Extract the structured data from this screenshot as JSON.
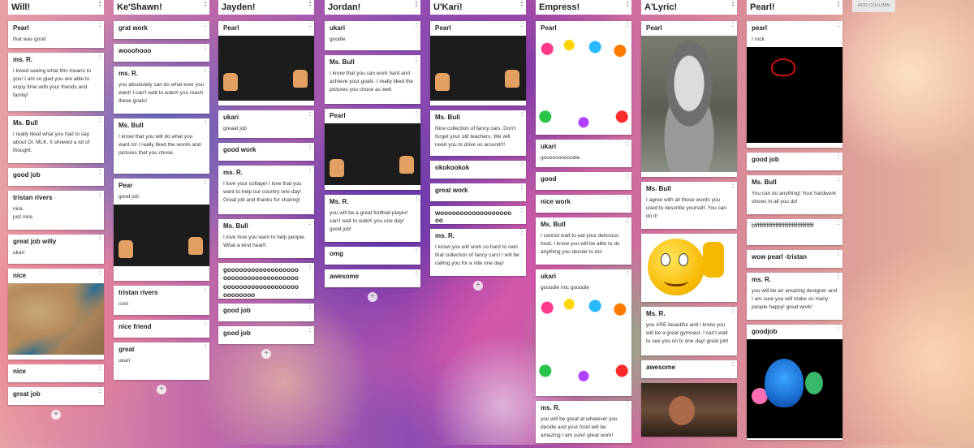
{
  "board": {
    "add_column_label": "ADD COLUMN",
    "add_card_symbol": "+",
    "kebab_symbol": "⋮"
  },
  "columns": [
    {
      "title": "Will!",
      "cards": [
        {
          "author": "Pearl",
          "body": "that was good"
        },
        {
          "author": "ms. R.",
          "body": "I loved seeing what this means to you! I am so glad you are able to enjoy time with your friends and family!"
        },
        {
          "author": "Ms. Bull",
          "body": "I really liked what you had to say about Dr. MLK.  It showed a lot of thought."
        },
        {
          "author": "good job",
          "body": ""
        },
        {
          "author": "tristan rivers",
          "body": "nice.\njust nice."
        },
        {
          "author": "great job willy",
          "body": "ukari"
        },
        {
          "author": "nice",
          "body": "",
          "image": "satellite-map"
        },
        {
          "author": "nice",
          "body": ""
        },
        {
          "author": "great job",
          "body": ""
        }
      ]
    },
    {
      "title": "Ke'Shawn!",
      "cards": [
        {
          "author": "grat work",
          "body": ""
        },
        {
          "author": "wooohooo",
          "body": ""
        },
        {
          "author": "ms. R.",
          "body": "you absolutely can do what ever you want! I can't wait to watch you reach these goals!"
        },
        {
          "author": "Ms. Bull",
          "body": "I know that you will do what you want to!  I really liked the words and pictures that you chose."
        },
        {
          "author": "Pear",
          "body": "good job",
          "image": "good-job-chalkboard"
        },
        {
          "author": "tristan rivers",
          "body": "cool"
        },
        {
          "author": "nice friend",
          "body": ""
        },
        {
          "author": "great",
          "body": "ukari"
        }
      ]
    },
    {
      "title": "Jayden!",
      "cards": [
        {
          "author": "Pearl",
          "body": "",
          "image": "good-job-chalkboard"
        },
        {
          "author": "ukari",
          "body": "greaat job"
        },
        {
          "author": "good work",
          "body": ""
        },
        {
          "author": "ms. R.",
          "body": "I love your collage! I love that you want to help our country one day! Great job and thanks for sharing!"
        },
        {
          "author": "Ms. Bull",
          "body": "I love how you want to help people.  What a kind heart!"
        },
        {
          "author": "goooooooooooooooooooooooooooooooooooooooooooooooooooooooooooooooo",
          "body": ""
        },
        {
          "author": "good job",
          "body": ""
        },
        {
          "author": "good job",
          "body": ""
        }
      ]
    },
    {
      "title": "Jordan!",
      "cards": [
        {
          "author": "ukari",
          "body": "goodie"
        },
        {
          "author": "Ms. Bull",
          "body": "I know that you can work hard and achieve your goals.  I really liked the pictures you chose as well."
        },
        {
          "author": "Pearl",
          "body": "",
          "image": "good-job-chalkboard"
        },
        {
          "author": "Ms. R.",
          "body": "you will be a great football player! can't wait to watch you one day! good job!"
        },
        {
          "author": "omg",
          "body": ""
        },
        {
          "author": "awesome",
          "body": ""
        }
      ]
    },
    {
      "title": "U'Kari!",
      "cards": [
        {
          "author": "Pearl",
          "body": "",
          "image": "good-job-chalkboard"
        },
        {
          "author": "Ms. Bull",
          "body": "Nice collection of fancy cars.  Don't forget your old teachers.  We will need you to drive us around!!!"
        },
        {
          "author": "okokookok",
          "body": ""
        },
        {
          "author": "great work",
          "body": ""
        },
        {
          "author": "woooooooooooooooooooo",
          "body": ""
        },
        {
          "author": "ms. R.",
          "body": "I know you will work so hard to own that collection of fancy cars! I will be calling you for a ride one day!"
        }
      ]
    },
    {
      "title": "Empress!",
      "cards": [
        {
          "author": "Pearl",
          "body": "",
          "image": "good-job-colorful"
        },
        {
          "author": "ukari",
          "body": "goooooooooodie"
        },
        {
          "author": "good",
          "body": ""
        },
        {
          "author": "nice work",
          "body": ""
        },
        {
          "author": "Ms. Bull",
          "body": "I cannot wait to eat your delicious food.  I know you will be able to do anything you decide to do!"
        },
        {
          "author": "ukari",
          "body": "gooodie mic gooodie",
          "image": "good-job-colorful"
        },
        {
          "author": "ms. R.",
          "body": "you will be great at whatever you decide and your food will be amazing I am sure! great work!"
        }
      ]
    },
    {
      "title": "A'Lyric!",
      "cards": [
        {
          "author": "Pearl",
          "body": "",
          "image": "raccoon-photo"
        },
        {
          "author": "Ms. Bull",
          "body": "I agree with all those words you used to describe yourself.  You can do it!"
        },
        {
          "author": "",
          "body": "",
          "image": "smiley-thumbs-up"
        },
        {
          "author": "Ms. R.",
          "body": "you ARE beautiful and  I know you will be a great gymnast. I  can't wait to see you on tv one day! great  job!"
        },
        {
          "author": "awesome",
          "body": ""
        },
        {
          "author": "",
          "body": "",
          "image": "selfie-photo"
        }
      ]
    },
    {
      "title": "Pearl!",
      "cards": [
        {
          "author": "pearl",
          "body": "I rock",
          "image": "i-rock"
        },
        {
          "author": "good job",
          "body": ""
        },
        {
          "author": "Ms. Bull",
          "body": "You can do anything!  Your hardwork shows in all you do!"
        },
        {
          "author": "bffffffffffffffffffffffffffffffffffffffff",
          "body": ""
        },
        {
          "author": "wow pearl -tristan",
          "body": ""
        },
        {
          "author": "ms. R.",
          "body": "you will be an amazing designer and I am sure you will make so many people happy! great work!"
        },
        {
          "author": "goodjob",
          "body": "",
          "image": "peacock-cartoon"
        }
      ]
    }
  ]
}
